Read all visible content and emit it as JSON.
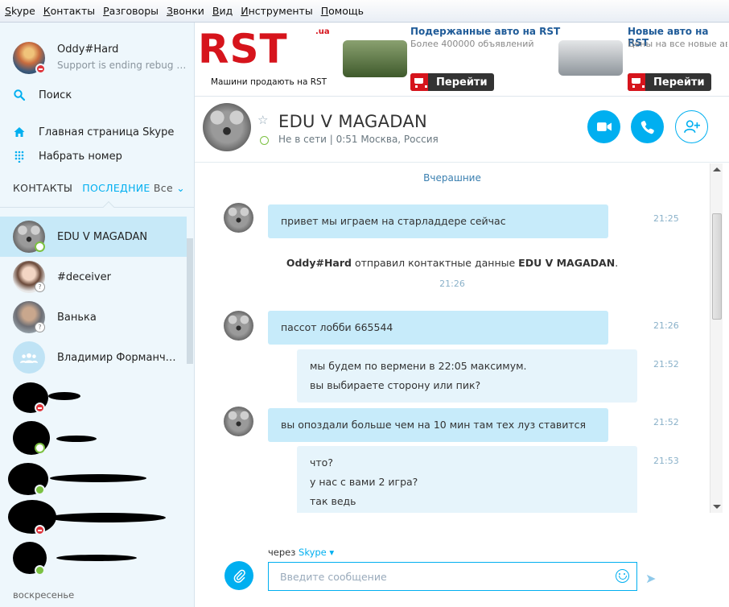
{
  "menu": [
    "Skype",
    "Контакты",
    "Разговоры",
    "Звонки",
    "Вид",
    "Инструменты",
    "Помощь"
  ],
  "profile": {
    "name": "Oddy#Hard",
    "mood": "Support is ending rebug off..."
  },
  "search_label": "Поиск",
  "nav": {
    "home": "Главная страница Skype",
    "dial": "Набрать номер"
  },
  "tabs": {
    "contacts": "КОНТАКТЫ",
    "recent": "ПОСЛЕДНИЕ",
    "filter": "Все"
  },
  "recent": [
    {
      "name": "EDU V MAGADAN",
      "status": "online"
    },
    {
      "name": "#deceiver",
      "status": "unknown"
    },
    {
      "name": "Ванька",
      "status": "unknown"
    },
    {
      "name": "Владимир Форманчук,...",
      "status": "group"
    }
  ],
  "recent_day": "воскресенье",
  "ad": {
    "brand": "RST",
    "brand_suffix": ".ua",
    "slogan": "Машини продають на RST",
    "offer1_title": "Подержанные авто на RST",
    "offer1_sub": "Более 400000 объявлений",
    "offer2_title": "Новые авто на RST",
    "offer2_sub": "Цены на все новые авто",
    "go_label": "Перейти"
  },
  "contact": {
    "name": "EDU V MAGADAN",
    "status": "Не в сети",
    "local_time": "0:51 Москва, Россия"
  },
  "chat": {
    "day_label": "Вчерашние",
    "messages": [
      {
        "text": "привет мы играем на старладдере сейчас",
        "time": "21:25"
      },
      {
        "text": "пассот лобби 665544",
        "time": "21:26"
      },
      {
        "line1": "мы будем по вермени в 22:05 максимум.",
        "line2": "вы выбираете сторону или пик?",
        "time": "21:52"
      },
      {
        "text": "вы опоздали больше чем на 10 мин там тех луз ставится",
        "time": "21:52"
      },
      {
        "line1": "что?",
        "line2": "у нас с вами 2 игра?",
        "line3": "так ведь",
        "time": "21:53"
      }
    ],
    "system": {
      "sender": "Oddy#Hard",
      "action": "отправил контактные данные",
      "contact": "EDU V MAGADAN",
      "time": "21:26"
    }
  },
  "compose": {
    "via_prefix": "через",
    "via_service": "Skype",
    "placeholder": "Введите сообщение"
  },
  "colors": {
    "accent": "#00aff0",
    "bubble_in": "#c7ebfa",
    "bubble_out": "#e6f4fb",
    "selected_row": "#c7e9f8",
    "rst_red": "#d6141c"
  }
}
